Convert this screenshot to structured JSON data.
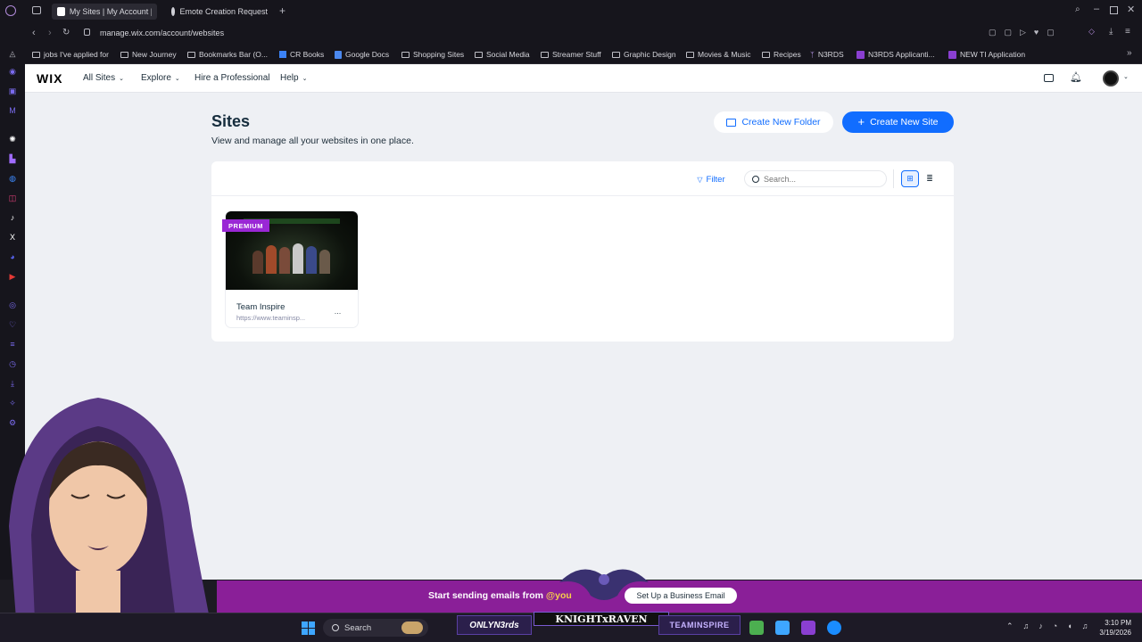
{
  "browser": {
    "tabs": [
      {
        "label": "My Sites | My Account | W",
        "active": true
      },
      {
        "label": "Emote Creation Request",
        "active": false
      }
    ],
    "url": "manage.wix.com/account/websites",
    "bookmarks": [
      "jobs I've applied for",
      "New Journey",
      "Bookmarks Bar (O...",
      "CR Books",
      "Google Docs",
      "Shopping Sites",
      "Social Media",
      "Streamer Stuff",
      "Graphic Design",
      "Movies & Music",
      "Recipes",
      "N3RDS",
      "N3RDS Applicanti...",
      "NEW TI Application"
    ]
  },
  "wix": {
    "logo": "WIX",
    "nav": {
      "all_sites": "All Sites",
      "explore": "Explore",
      "hire": "Hire a Professional",
      "help": "Help"
    },
    "page_title": "Sites",
    "page_subtitle": "View and manage all your websites in one place.",
    "create_folder": "Create New Folder",
    "create_site": "Create New Site",
    "filter": "Filter",
    "search_placeholder": "Search...",
    "site": {
      "badge": "PREMIUM",
      "name": "Team Inspire",
      "url": "https://www.teaminsp...",
      "more": "..."
    },
    "accent_color": "#116dff",
    "premium_color": "#9a27d5"
  },
  "overlay": {
    "promo_text": "Start sending emails from ",
    "promo_handle": "@you",
    "promo_button": "Set Up a Business Email",
    "knight_raven": "KNIGHTxRAVEN",
    "only_n3rds": "ONLYN3rds",
    "team_inspire": "TEAMINSPIRE"
  },
  "taskbar": {
    "search_label": "Search",
    "time": "3:10 PM",
    "date": "3/19/2026"
  }
}
